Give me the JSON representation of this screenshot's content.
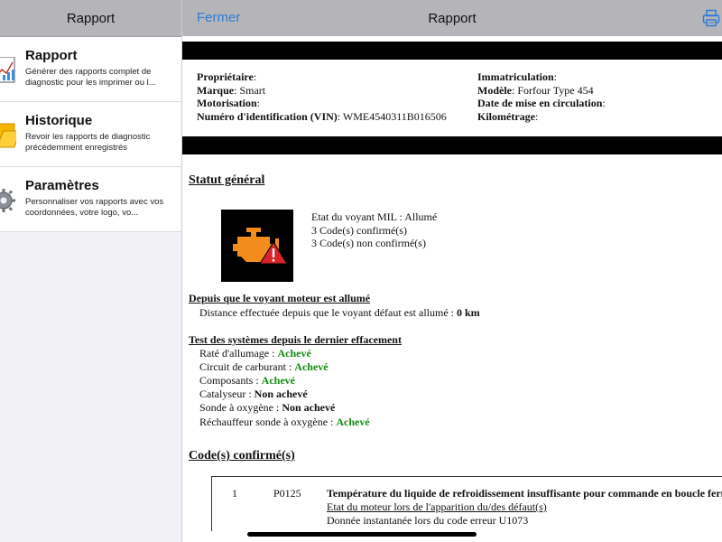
{
  "sidebar": {
    "title": "Rapport",
    "items": [
      {
        "title": "Rapport",
        "desc": "Générer des rapports complet de diagnostic pour les imprimer ou l..."
      },
      {
        "title": "Historique",
        "desc": "Revoir les rapports de diagnostic précédemment enregistrés"
      },
      {
        "title": "Paramètres",
        "desc": "Personnaliser vos rapports avec vos coordonnées, votre logo, vo..."
      }
    ]
  },
  "header": {
    "close_label": "Fermer",
    "title": "Rapport"
  },
  "vehicle": {
    "left": [
      {
        "label": "Propriétaire",
        "sep": ":",
        "value": ""
      },
      {
        "label": "Marque",
        "sep": ": ",
        "value": "Smart"
      },
      {
        "label": "Motorisation",
        "sep": ":",
        "value": ""
      },
      {
        "label": "Numéro d'identification (VIN)",
        "sep": ": ",
        "value": "WME4540311B016506"
      }
    ],
    "right": [
      {
        "label": "Immatriculation",
        "sep": ":",
        "value": ""
      },
      {
        "label": "Modèle",
        "sep": ": ",
        "value": "Forfour Type 454"
      },
      {
        "label": "Date de mise en circulation",
        "sep": ":",
        "value": ""
      },
      {
        "label": "Kilométrage",
        "sep": ":",
        "value": ""
      }
    ]
  },
  "status": {
    "title": "Statut général",
    "mil": "Etat du voyant MIL : Allumé",
    "confirmed": "3 Code(s) confirmé(s)",
    "unconfirmed": "3 Code(s) non confirmé(s)"
  },
  "since_mil": {
    "title": "Depuis que le voyant moteur est allumé",
    "distance_label": "Distance effectuée depuis que le voyant défaut est allumé : ",
    "distance_value": "0 km"
  },
  "tests": {
    "title": "Test des systèmes depuis le dernier effacement",
    "items": [
      {
        "label": "Raté d'allumage : ",
        "value": "Achevé",
        "status": "done"
      },
      {
        "label": "Circuit de carburant : ",
        "value": "Achevé",
        "status": "done"
      },
      {
        "label": "Composants : ",
        "value": "Achevé",
        "status": "done"
      },
      {
        "label": "Catalyseur : ",
        "value": "Non achevé",
        "status": "not-done"
      },
      {
        "label": "Sonde à oxygène : ",
        "value": "Non achevé",
        "status": "not-done"
      },
      {
        "label": "Réchauffeur sonde à oxygène : ",
        "value": "Achevé",
        "status": "done"
      }
    ]
  },
  "codes": {
    "title": "Code(s) confirmé(s)",
    "rows": [
      {
        "num": "1",
        "code": "P0125",
        "desc": "Température du liquide de refroidissement insuffisante pour commande en boucle fermée",
        "link": "Etat du moteur lors de l'apparition du/des défaut(s)",
        "snapshot": "Donnée instantanée lors du code erreur U1073"
      }
    ]
  },
  "icons": {
    "report": "report-chart-icon",
    "history": "folder-icon",
    "settings": "gear-icon",
    "print": "printer-icon",
    "engine": "check-engine-icon"
  },
  "colors": {
    "accent": "#2e7bd6",
    "achieved": "#138a13",
    "engine": "#f28c1c",
    "warning": "#d8232a"
  }
}
